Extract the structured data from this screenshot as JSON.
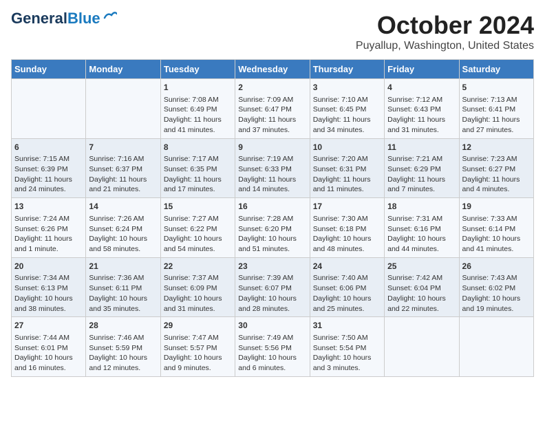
{
  "header": {
    "logo_line1": "General",
    "logo_line2": "Blue",
    "title": "October 2024",
    "subtitle": "Puyallup, Washington, United States"
  },
  "days_of_week": [
    "Sunday",
    "Monday",
    "Tuesday",
    "Wednesday",
    "Thursday",
    "Friday",
    "Saturday"
  ],
  "weeks": [
    [
      {
        "day": "",
        "sunrise": "",
        "sunset": "",
        "daylight": ""
      },
      {
        "day": "",
        "sunrise": "",
        "sunset": "",
        "daylight": ""
      },
      {
        "day": "1",
        "sunrise": "Sunrise: 7:08 AM",
        "sunset": "Sunset: 6:49 PM",
        "daylight": "Daylight: 11 hours and 41 minutes."
      },
      {
        "day": "2",
        "sunrise": "Sunrise: 7:09 AM",
        "sunset": "Sunset: 6:47 PM",
        "daylight": "Daylight: 11 hours and 37 minutes."
      },
      {
        "day": "3",
        "sunrise": "Sunrise: 7:10 AM",
        "sunset": "Sunset: 6:45 PM",
        "daylight": "Daylight: 11 hours and 34 minutes."
      },
      {
        "day": "4",
        "sunrise": "Sunrise: 7:12 AM",
        "sunset": "Sunset: 6:43 PM",
        "daylight": "Daylight: 11 hours and 31 minutes."
      },
      {
        "day": "5",
        "sunrise": "Sunrise: 7:13 AM",
        "sunset": "Sunset: 6:41 PM",
        "daylight": "Daylight: 11 hours and 27 minutes."
      }
    ],
    [
      {
        "day": "6",
        "sunrise": "Sunrise: 7:15 AM",
        "sunset": "Sunset: 6:39 PM",
        "daylight": "Daylight: 11 hours and 24 minutes."
      },
      {
        "day": "7",
        "sunrise": "Sunrise: 7:16 AM",
        "sunset": "Sunset: 6:37 PM",
        "daylight": "Daylight: 11 hours and 21 minutes."
      },
      {
        "day": "8",
        "sunrise": "Sunrise: 7:17 AM",
        "sunset": "Sunset: 6:35 PM",
        "daylight": "Daylight: 11 hours and 17 minutes."
      },
      {
        "day": "9",
        "sunrise": "Sunrise: 7:19 AM",
        "sunset": "Sunset: 6:33 PM",
        "daylight": "Daylight: 11 hours and 14 minutes."
      },
      {
        "day": "10",
        "sunrise": "Sunrise: 7:20 AM",
        "sunset": "Sunset: 6:31 PM",
        "daylight": "Daylight: 11 hours and 11 minutes."
      },
      {
        "day": "11",
        "sunrise": "Sunrise: 7:21 AM",
        "sunset": "Sunset: 6:29 PM",
        "daylight": "Daylight: 11 hours and 7 minutes."
      },
      {
        "day": "12",
        "sunrise": "Sunrise: 7:23 AM",
        "sunset": "Sunset: 6:27 PM",
        "daylight": "Daylight: 11 hours and 4 minutes."
      }
    ],
    [
      {
        "day": "13",
        "sunrise": "Sunrise: 7:24 AM",
        "sunset": "Sunset: 6:26 PM",
        "daylight": "Daylight: 11 hours and 1 minute."
      },
      {
        "day": "14",
        "sunrise": "Sunrise: 7:26 AM",
        "sunset": "Sunset: 6:24 PM",
        "daylight": "Daylight: 10 hours and 58 minutes."
      },
      {
        "day": "15",
        "sunrise": "Sunrise: 7:27 AM",
        "sunset": "Sunset: 6:22 PM",
        "daylight": "Daylight: 10 hours and 54 minutes."
      },
      {
        "day": "16",
        "sunrise": "Sunrise: 7:28 AM",
        "sunset": "Sunset: 6:20 PM",
        "daylight": "Daylight: 10 hours and 51 minutes."
      },
      {
        "day": "17",
        "sunrise": "Sunrise: 7:30 AM",
        "sunset": "Sunset: 6:18 PM",
        "daylight": "Daylight: 10 hours and 48 minutes."
      },
      {
        "day": "18",
        "sunrise": "Sunrise: 7:31 AM",
        "sunset": "Sunset: 6:16 PM",
        "daylight": "Daylight: 10 hours and 44 minutes."
      },
      {
        "day": "19",
        "sunrise": "Sunrise: 7:33 AM",
        "sunset": "Sunset: 6:14 PM",
        "daylight": "Daylight: 10 hours and 41 minutes."
      }
    ],
    [
      {
        "day": "20",
        "sunrise": "Sunrise: 7:34 AM",
        "sunset": "Sunset: 6:13 PM",
        "daylight": "Daylight: 10 hours and 38 minutes."
      },
      {
        "day": "21",
        "sunrise": "Sunrise: 7:36 AM",
        "sunset": "Sunset: 6:11 PM",
        "daylight": "Daylight: 10 hours and 35 minutes."
      },
      {
        "day": "22",
        "sunrise": "Sunrise: 7:37 AM",
        "sunset": "Sunset: 6:09 PM",
        "daylight": "Daylight: 10 hours and 31 minutes."
      },
      {
        "day": "23",
        "sunrise": "Sunrise: 7:39 AM",
        "sunset": "Sunset: 6:07 PM",
        "daylight": "Daylight: 10 hours and 28 minutes."
      },
      {
        "day": "24",
        "sunrise": "Sunrise: 7:40 AM",
        "sunset": "Sunset: 6:06 PM",
        "daylight": "Daylight: 10 hours and 25 minutes."
      },
      {
        "day": "25",
        "sunrise": "Sunrise: 7:42 AM",
        "sunset": "Sunset: 6:04 PM",
        "daylight": "Daylight: 10 hours and 22 minutes."
      },
      {
        "day": "26",
        "sunrise": "Sunrise: 7:43 AM",
        "sunset": "Sunset: 6:02 PM",
        "daylight": "Daylight: 10 hours and 19 minutes."
      }
    ],
    [
      {
        "day": "27",
        "sunrise": "Sunrise: 7:44 AM",
        "sunset": "Sunset: 6:01 PM",
        "daylight": "Daylight: 10 hours and 16 minutes."
      },
      {
        "day": "28",
        "sunrise": "Sunrise: 7:46 AM",
        "sunset": "Sunset: 5:59 PM",
        "daylight": "Daylight: 10 hours and 12 minutes."
      },
      {
        "day": "29",
        "sunrise": "Sunrise: 7:47 AM",
        "sunset": "Sunset: 5:57 PM",
        "daylight": "Daylight: 10 hours and 9 minutes."
      },
      {
        "day": "30",
        "sunrise": "Sunrise: 7:49 AM",
        "sunset": "Sunset: 5:56 PM",
        "daylight": "Daylight: 10 hours and 6 minutes."
      },
      {
        "day": "31",
        "sunrise": "Sunrise: 7:50 AM",
        "sunset": "Sunset: 5:54 PM",
        "daylight": "Daylight: 10 hours and 3 minutes."
      },
      {
        "day": "",
        "sunrise": "",
        "sunset": "",
        "daylight": ""
      },
      {
        "day": "",
        "sunrise": "",
        "sunset": "",
        "daylight": ""
      }
    ]
  ]
}
